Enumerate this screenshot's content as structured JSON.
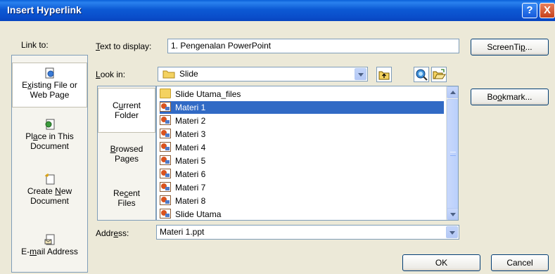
{
  "window": {
    "title": "Insert Hyperlink",
    "help_glyph": "?",
    "close_glyph": "X"
  },
  "link_to": {
    "label": "Link to:",
    "items": [
      {
        "pre": "E",
        "ul": "x",
        "post": "isting File or",
        "line2": "Web Page",
        "icon": "existing-file-icon",
        "selected": true
      },
      {
        "pre": "Pl",
        "ul": "a",
        "post": "ce in This",
        "line2": "Document",
        "icon": "place-in-document-icon",
        "selected": false
      },
      {
        "pre": "Create ",
        "ul": "N",
        "post": "ew",
        "line2": "Document",
        "icon": "new-document-icon",
        "selected": false
      },
      {
        "pre": "E-",
        "ul": "m",
        "post": "ail Address",
        "line2": "",
        "icon": "email-address-icon",
        "selected": false
      }
    ]
  },
  "text_to_display": {
    "ul": "T",
    "rest": "ext to display:",
    "value": "1. Pengenalan PowerPoint"
  },
  "screentip_button": {
    "pre": "ScreenTi",
    "ul": "p",
    "post": "..."
  },
  "look_in": {
    "ul": "L",
    "rest": "ook in:",
    "value": "Slide"
  },
  "tabs": [
    {
      "pre": "C",
      "ul": "u",
      "post": "rrent",
      "line2": "Folder",
      "selected": true
    },
    {
      "pre": "",
      "ul": "B",
      "post": "rowsed",
      "line2": "Pages",
      "selected": false
    },
    {
      "pre": "Re",
      "ul": "c",
      "post": "ent",
      "line2": "Files",
      "selected": false
    }
  ],
  "files": [
    {
      "name": "Slide Utama_files",
      "type": "folder",
      "selected": false
    },
    {
      "name": "Materi 1",
      "type": "ppt",
      "selected": true
    },
    {
      "name": "Materi 2",
      "type": "ppt",
      "selected": false
    },
    {
      "name": "Materi 3",
      "type": "ppt",
      "selected": false
    },
    {
      "name": "Materi 4",
      "type": "ppt",
      "selected": false
    },
    {
      "name": "Materi 5",
      "type": "ppt",
      "selected": false
    },
    {
      "name": "Materi 6",
      "type": "ppt",
      "selected": false
    },
    {
      "name": "Materi 7",
      "type": "ppt",
      "selected": false
    },
    {
      "name": "Materi 8",
      "type": "ppt",
      "selected": false
    },
    {
      "name": "Slide Utama",
      "type": "ppt",
      "selected": false
    }
  ],
  "bookmark_button": {
    "pre": "Bo",
    "ul": "o",
    "post": "kmark..."
  },
  "address": {
    "pre": "Addr",
    "ul": "e",
    "post": "ss:",
    "value": "Materi 1.ppt"
  },
  "ok_label": "OK",
  "cancel_label": "Cancel"
}
